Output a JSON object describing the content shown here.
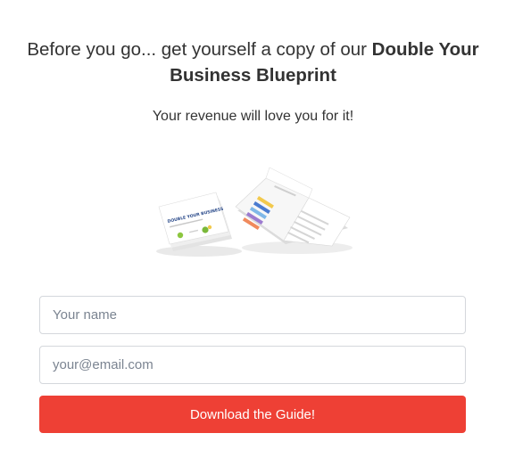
{
  "optin": {
    "headline_prefix": "Before you go... get yourself a copy of our ",
    "headline_bold": "Double Your Business Blueprint",
    "subheadline": "Your revenue will love you for it!",
    "product_cover_title": "DOUBLE YOUR BUSINESS",
    "name_placeholder": "Your name",
    "email_placeholder": "your@email.com",
    "submit_label": "Download the Guide!"
  },
  "colors": {
    "button": "#ee4035",
    "text": "#333333",
    "placeholder": "#7b8491",
    "border": "#d4d7dc"
  }
}
